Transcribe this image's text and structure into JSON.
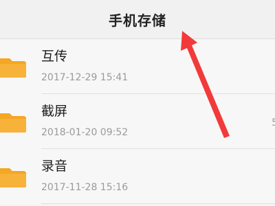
{
  "header": {
    "title": "手机存储"
  },
  "files": [
    {
      "name": "互传",
      "date": "2017-12-29 15:41",
      "icon": "folder-icon"
    },
    {
      "name": "截屏",
      "date": "2018-01-20 09:52",
      "size": "5",
      "icon": "folder-icon"
    },
    {
      "name": "录音",
      "date": "2017-11-28 15:16",
      "icon": "folder-icon"
    }
  ],
  "colors": {
    "folder": "#f5a623",
    "arrow": "#f23a3a"
  }
}
